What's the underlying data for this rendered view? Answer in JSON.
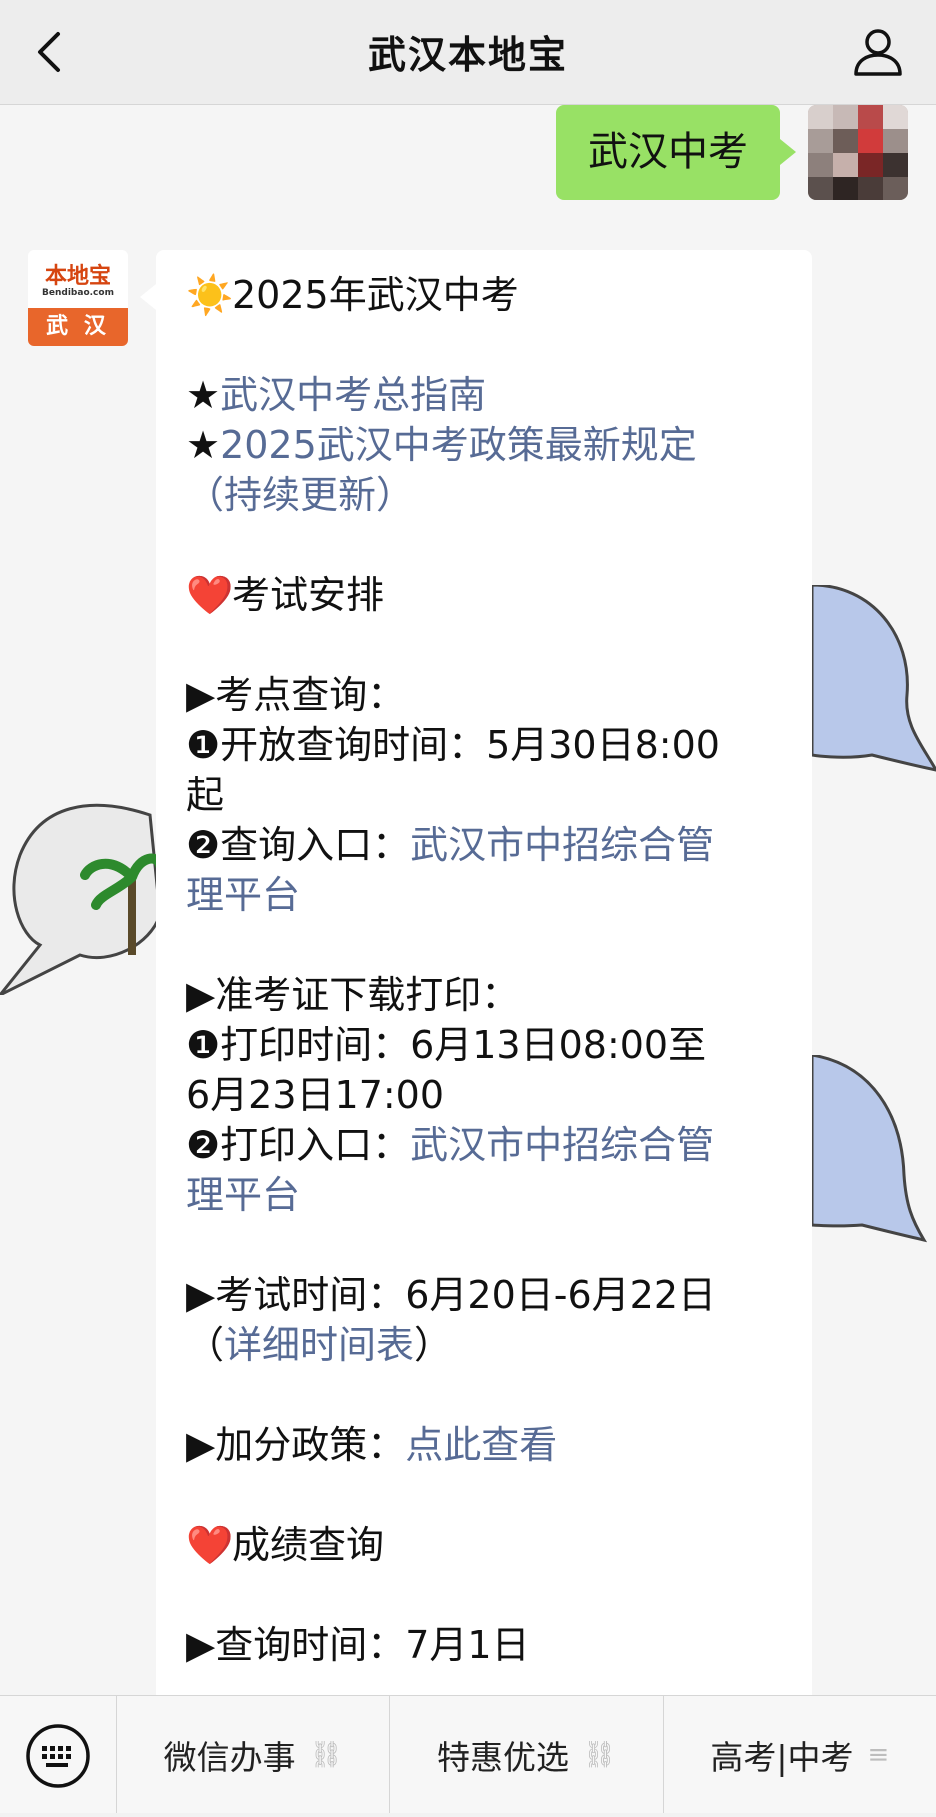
{
  "header": {
    "title": "武汉本地宝"
  },
  "user_message": {
    "text": "武汉中考"
  },
  "bot": {
    "avatar": {
      "logo_top": "本地宝",
      "logo_mid": "Bendibao.com",
      "logo_city": "武 汉"
    },
    "lines": [
      "☀️2025年武汉中考",
      "",
      "★武汉中考总指南",
      "★2025武汉中考政策最新规定",
      "（持续更新）",
      "",
      "❤️考试安排",
      "",
      "▶考点查询：",
      "❶开放查询时间：5月30日8:00",
      "起",
      "❷查询入口：武汉市中招综合管",
      "理平台",
      "",
      "▶准考证下载打印：",
      "❶打印时间：6月13日08:00至",
      "6月23日17:00",
      "❷打印入口：武汉市中招综合管",
      "理平台",
      "",
      "▶考试时间：6月20日-6月22日",
      "（详细时间表）",
      "",
      "▶加分政策：点此查看",
      "",
      "❤️成绩查询",
      "",
      "▶查询时间：7月1日"
    ],
    "parts": {
      "intro_sun": "☀️",
      "intro_text": "2025年武汉中考",
      "star": "★",
      "guide_link": "武汉中考总指南",
      "policy_link": "2025武汉中考政策最新规定",
      "policy_link_2": "（持续更新）",
      "heart": "❤️",
      "exam_arrange": "考试安排",
      "kd_title": "▶考点查询：",
      "kd_1": "❶开放查询时间：5月30日8:00",
      "kd_1b": "起",
      "kd_2_label": "❷查询入口：",
      "kd_2_link_a": "武汉市中招综合管",
      "kd_2_link_b": "理平台",
      "zkz_title": "▶准考证下载打印：",
      "zkz_1": "❶打印时间：6月13日08:00至",
      "zkz_1b": "6月23日17:00",
      "zkz_2_label": "❷打印入口：",
      "zkz_2_link_a": "武汉市中招综合管",
      "zkz_2_link_b": "理平台",
      "time_label": "▶考试时间：6月20日-6月22日",
      "time_paren_open": "（",
      "time_link": "详细时间表",
      "time_paren_close": "）",
      "bonus_label": "▶加分政策：",
      "bonus_link": "点此查看",
      "score_title": "成绩查询",
      "score_time": "▶查询时间：7月1日"
    }
  },
  "bottom_menu": {
    "items": [
      {
        "label": "微信办事",
        "icon": "link-icon",
        "glyph": "⛓"
      },
      {
        "label": "特惠优选",
        "icon": "link-icon",
        "glyph": "⛓"
      },
      {
        "label": "高考|中考",
        "icon": "menu-icon",
        "glyph": "≡"
      }
    ]
  },
  "colors": {
    "link": "#576b95",
    "user_bubble": "#98e165",
    "brand": "#e8662b"
  }
}
